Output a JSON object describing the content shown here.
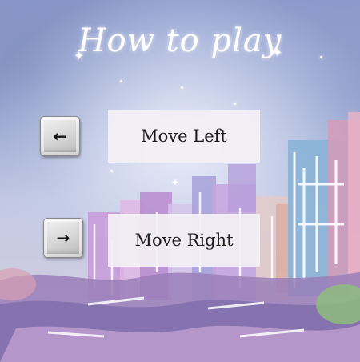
{
  "screen": {
    "title": "How to play"
  },
  "controls": [
    {
      "key_glyph": "←",
      "key_icon": "left-arrow-key-icon",
      "action": "Move Left"
    },
    {
      "key_glyph": "→",
      "key_icon": "right-arrow-key-icon",
      "action": "Move Right"
    }
  ],
  "colors": {
    "sky": "#8f9ccd",
    "label_bg": "#f3f0f4",
    "title": "#ffffff"
  }
}
